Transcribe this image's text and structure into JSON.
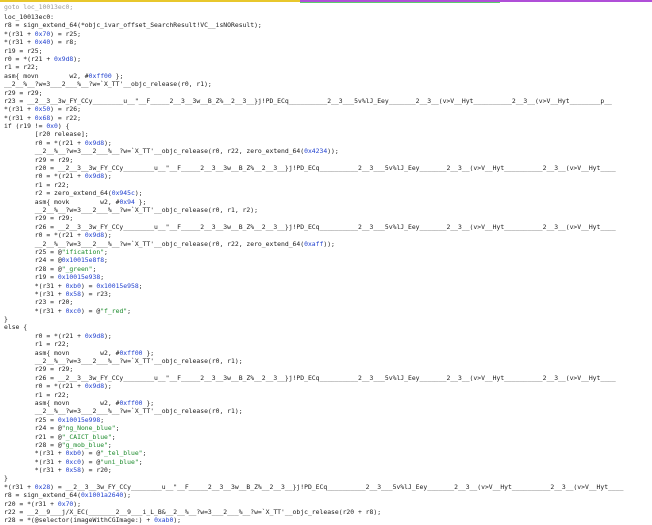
{
  "colors": {
    "text": "#1a1a1a",
    "number": "#1f3fcf",
    "string": "#1a8a2a",
    "accent_bar_yellow": "#e8c72c",
    "accent_bar_purple": "#b04fd8",
    "accent_bar_green": "#5ccf6b"
  },
  "top_label": "goto loc_10013ec0;",
  "lines": [
    [
      {
        "t": "loc_10013ec0:",
        "c": "k"
      }
    ],
    [
      {
        "t": "r8 = sign_extend_64(*objc_ivar_offset_SearchResult!VC__isNOResult);",
        "c": "k"
      }
    ],
    [
      {
        "t": "*(r31 + ",
        "c": "k"
      },
      {
        "t": "0x70",
        "c": "num"
      },
      {
        "t": ") = r25;",
        "c": "k"
      }
    ],
    [
      {
        "t": "*(r31 + ",
        "c": "k"
      },
      {
        "t": "0x40",
        "c": "num"
      },
      {
        "t": ") = r8;",
        "c": "k"
      }
    ],
    [
      {
        "t": "r19 = r25;",
        "c": "k"
      }
    ],
    [
      {
        "t": "r0 = *(r21 + ",
        "c": "k"
      },
      {
        "t": "0x9d8",
        "c": "num"
      },
      {
        "t": ");",
        "c": "k"
      }
    ],
    [
      {
        "t": "r1 = r22;",
        "c": "k"
      }
    ],
    [
      {
        "t": "asm{ movn        w2, #",
        "c": "k"
      },
      {
        "t": "0xff00",
        "c": "num"
      },
      {
        "t": " };",
        "c": "k"
      }
    ],
    [
      {
        "t": "__2__%__?w=3___2___%__?w=`X_TT'__objc_release(r0, r1);",
        "c": "k"
      }
    ],
    [
      {
        "t": "r29 = r29;",
        "c": "k"
      }
    ],
    [
      {
        "t": "r23 = __2__3__3w_FY_CCy________u__\"__F_____2__3__3w__B_Z%__2__3__}j!PD_ECq__________2__3___5v%lJ_Eey_______2__3__(v>V__Hyt__________2__3__(v>V__Hyt________p__",
        "c": "k"
      }
    ],
    [
      {
        "t": "*(r31 + ",
        "c": "k"
      },
      {
        "t": "0x50",
        "c": "num"
      },
      {
        "t": ") = r26;",
        "c": "k"
      }
    ],
    [
      {
        "t": "*(r31 + ",
        "c": "k"
      },
      {
        "t": "0x68",
        "c": "num"
      },
      {
        "t": ") = r22;",
        "c": "k"
      }
    ],
    [
      {
        "t": "if (r19 != ",
        "c": "k"
      },
      {
        "t": "0x0",
        "c": "num"
      },
      {
        "t": ") {",
        "c": "k"
      }
    ],
    [
      {
        "t": "        [r20 release];",
        "c": "k"
      }
    ],
    [
      {
        "t": "        r0 = *(r21 + ",
        "c": "k"
      },
      {
        "t": "0x9d8",
        "c": "num"
      },
      {
        "t": ");",
        "c": "k"
      }
    ],
    [
      {
        "t": "        __2__%__?w=3___2___%__?w=`X_TT'__objc_release(r0, r22, zero_extend_64(",
        "c": "k"
      },
      {
        "t": "0x4234",
        "c": "num"
      },
      {
        "t": "));",
        "c": "k"
      }
    ],
    [
      {
        "t": "        r29 = r29;",
        "c": "k"
      }
    ],
    [
      {
        "t": "        r20 = __2__3__3w_FY_CCy________u__\"__F_____2__3__3w__B_Z%__2__3__}j!PD_ECq__________2__3___5v%lJ_Eey_______2__3__(v>V__Hyt__________2__3__(v>V__Hyt____",
        "c": "k"
      }
    ],
    [
      {
        "t": "        r0 = *(r21 + ",
        "c": "k"
      },
      {
        "t": "0x9d8",
        "c": "num"
      },
      {
        "t": ");",
        "c": "k"
      }
    ],
    [
      {
        "t": "        r1 = r22;",
        "c": "k"
      }
    ],
    [
      {
        "t": "        r2 = zero_extend_64(",
        "c": "k"
      },
      {
        "t": "0x945c",
        "c": "num"
      },
      {
        "t": ");",
        "c": "k"
      }
    ],
    [
      {
        "t": "        asm{ movk        w2, #",
        "c": "k"
      },
      {
        "t": "0x94",
        "c": "num"
      },
      {
        "t": " };",
        "c": "k"
      }
    ],
    [
      {
        "t": "        __2__%__?w=3___2___%__?w=`X_TT'__objc_release(r0, r1, r2);",
        "c": "k"
      }
    ],
    [
      {
        "t": "        r29 = r29;",
        "c": "k"
      }
    ],
    [
      {
        "t": "        r26 = __2__3__3w_FY_CCy________u__\"__F_____2__3__3w__B_Z%__2__3__}j!PD_ECq__________2__3___5v%lJ_Eey_______2__3__(v>V__Hyt__________2__3__(v>V__Hyt____",
        "c": "k"
      }
    ],
    [
      {
        "t": "        r0 = *(r21 + ",
        "c": "k"
      },
      {
        "t": "0x9d8",
        "c": "num"
      },
      {
        "t": ");",
        "c": "k"
      }
    ],
    [
      {
        "t": "        __2__%__?w=3___2___%__?w=`X_TT'__objc_release(r0, r22, zero_extend_64(",
        "c": "k"
      },
      {
        "t": "0xaff",
        "c": "num"
      },
      {
        "t": "));",
        "c": "k"
      }
    ],
    [
      {
        "t": "        r25 = @",
        "c": "k"
      },
      {
        "t": "\"ification\"",
        "c": "str"
      },
      {
        "t": ";",
        "c": "k"
      }
    ],
    [
      {
        "t": "        r24 = @",
        "c": "k"
      },
      {
        "t": "0x10015e8f8",
        "c": "num"
      },
      {
        "t": ";",
        "c": "k"
      }
    ],
    [
      {
        "t": "        r28 = @",
        "c": "k"
      },
      {
        "t": "\"_green\"",
        "c": "str"
      },
      {
        "t": ";",
        "c": "k"
      }
    ],
    [
      {
        "t": "        r19 = ",
        "c": "k"
      },
      {
        "t": "0x10015e938",
        "c": "num"
      },
      {
        "t": ";",
        "c": "k"
      }
    ],
    [
      {
        "t": "        *(r31 + ",
        "c": "k"
      },
      {
        "t": "0xb0",
        "c": "num"
      },
      {
        "t": ") = ",
        "c": "k"
      },
      {
        "t": "0x10015e958",
        "c": "num"
      },
      {
        "t": ";",
        "c": "k"
      }
    ],
    [
      {
        "t": "        *(r31 + ",
        "c": "k"
      },
      {
        "t": "0x58",
        "c": "num"
      },
      {
        "t": ") = r23;",
        "c": "k"
      }
    ],
    [
      {
        "t": "        r23 = r20;",
        "c": "k"
      }
    ],
    [
      {
        "t": "        *(r31 + ",
        "c": "k"
      },
      {
        "t": "0xc0",
        "c": "num"
      },
      {
        "t": ") = @",
        "c": "k"
      },
      {
        "t": "\"f_red\"",
        "c": "str"
      },
      {
        "t": ";",
        "c": "k"
      }
    ],
    [
      {
        "t": "}",
        "c": "k"
      }
    ],
    [
      {
        "t": "else {",
        "c": "k"
      }
    ],
    [
      {
        "t": "        r0 = *(r21 + ",
        "c": "k"
      },
      {
        "t": "0x9d8",
        "c": "num"
      },
      {
        "t": ");",
        "c": "k"
      }
    ],
    [
      {
        "t": "        r1 = r22;",
        "c": "k"
      }
    ],
    [
      {
        "t": "        asm{ movn        w2, #",
        "c": "k"
      },
      {
        "t": "0xff00",
        "c": "num"
      },
      {
        "t": " };",
        "c": "k"
      }
    ],
    [
      {
        "t": "        __2__%__?w=3___2___%__?w=`X_TT'__objc_release(r0, r1);",
        "c": "k"
      }
    ],
    [
      {
        "t": "        r29 = r29;",
        "c": "k"
      }
    ],
    [
      {
        "t": "        r26 = __2__3__3w_FY_CCy________u__\"__F_____2__3__3w__B_Z%__2__3__}j!PD_ECq__________2__3___5v%lJ_Eey_______2__3__(v>V__Hyt__________2__3__(v>V__Hyt____",
        "c": "k"
      }
    ],
    [
      {
        "t": "        r0 = *(r21 + ",
        "c": "k"
      },
      {
        "t": "0x9d8",
        "c": "num"
      },
      {
        "t": ");",
        "c": "k"
      }
    ],
    [
      {
        "t": "        r1 = r22;",
        "c": "k"
      }
    ],
    [
      {
        "t": "        asm{ movn        w2, #",
        "c": "k"
      },
      {
        "t": "0xff00",
        "c": "num"
      },
      {
        "t": " };",
        "c": "k"
      }
    ],
    [
      {
        "t": "        __2__%__?w=3___2___%__?w=`X_TT'__objc_release(r0, r1);",
        "c": "k"
      }
    ],
    [
      {
        "t": "        r25 = ",
        "c": "k"
      },
      {
        "t": "0x10015e998",
        "c": "num"
      },
      {
        "t": ";",
        "c": "k"
      }
    ],
    [
      {
        "t": "        r24 = @",
        "c": "k"
      },
      {
        "t": "\"ng_None_blue\"",
        "c": "str"
      },
      {
        "t": ";",
        "c": "k"
      }
    ],
    [
      {
        "t": "        r21 = @",
        "c": "k"
      },
      {
        "t": "\"_CAICT_blue\"",
        "c": "str"
      },
      {
        "t": ";",
        "c": "k"
      }
    ],
    [
      {
        "t": "        r28 = @",
        "c": "k"
      },
      {
        "t": "\"g_mob_blue\"",
        "c": "str"
      },
      {
        "t": ";",
        "c": "k"
      }
    ],
    [
      {
        "t": "        *(r31 + ",
        "c": "k"
      },
      {
        "t": "0xb0",
        "c": "num"
      },
      {
        "t": ") = @",
        "c": "k"
      },
      {
        "t": "\"_tel_blue\"",
        "c": "str"
      },
      {
        "t": ";",
        "c": "k"
      }
    ],
    [
      {
        "t": "        *(r31 + ",
        "c": "k"
      },
      {
        "t": "0xc0",
        "c": "num"
      },
      {
        "t": ") = @",
        "c": "k"
      },
      {
        "t": "\"uni_blue\"",
        "c": "str"
      },
      {
        "t": ";",
        "c": "k"
      }
    ],
    [
      {
        "t": "        *(r31 + ",
        "c": "k"
      },
      {
        "t": "0x58",
        "c": "num"
      },
      {
        "t": ") = r20;",
        "c": "k"
      }
    ],
    [
      {
        "t": "}",
        "c": "k"
      }
    ],
    [
      {
        "t": "*(r31 + ",
        "c": "k"
      },
      {
        "t": "0x28",
        "c": "num"
      },
      {
        "t": ") = __2__3__3w_FY_CCy________u__\"__F_____2__3__3w__B_Z%__2__3__}j!PD_ECq__________2__3___5v%lJ_Eey_______2__3__(v>V__Hyt__________2__3__(v>V__Hyt____",
        "c": "k"
      }
    ],
    [
      {
        "t": "r8 = sign_extend_64(",
        "c": "k"
      },
      {
        "t": "0x1001a2640",
        "c": "num"
      },
      {
        "t": ");",
        "c": "k"
      }
    ],
    [
      {
        "t": "r20 = *(r31 + ",
        "c": "k"
      },
      {
        "t": "0x70",
        "c": "num"
      },
      {
        "t": ");",
        "c": "k"
      }
    ],
    [
      {
        "t": "r22 = __2__9___j/X_EC(_______2__9___i_L_B&__2__%__?w=3___2___%__?w=`X_TT'__objc_release(r20 + r8);",
        "c": "k"
      }
    ],
    [
      {
        "t": "r28 = *(@selector(imageWithCGImage:) + ",
        "c": "k"
      },
      {
        "t": "0xab0",
        "c": "num"
      },
      {
        "t": ");",
        "c": "k"
      }
    ]
  ]
}
